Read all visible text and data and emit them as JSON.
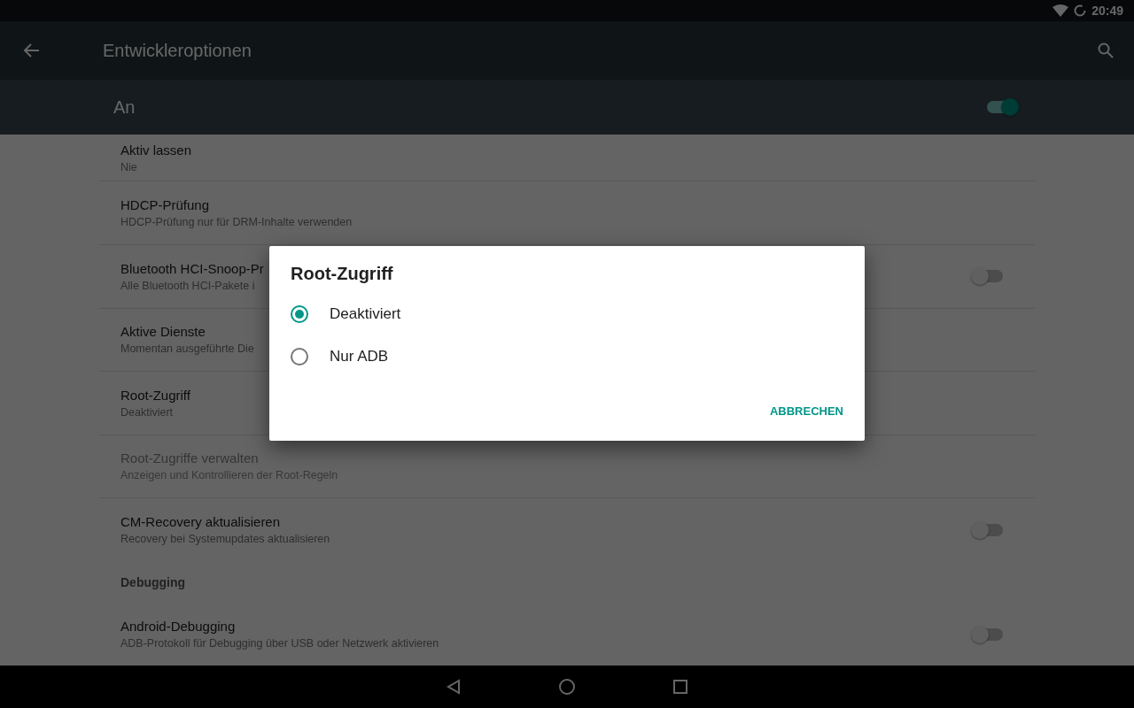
{
  "status_bar": {
    "time": "20:49"
  },
  "app_bar": {
    "title": "Entwickleroptionen"
  },
  "master_switch": {
    "label": "An",
    "on": true
  },
  "settings": [
    {
      "kind": "item",
      "title": "Aktiv lassen",
      "summary": "Nie",
      "disabled": false
    },
    {
      "kind": "item",
      "title": "HDCP-Prüfung",
      "summary": "HDCP-Prüfung nur für DRM-Inhalte verwenden",
      "disabled": false
    },
    {
      "kind": "switch",
      "title": "Bluetooth HCI-Snoop-Pr",
      "summary": "Alle Bluetooth HCI-Pakete i",
      "disabled": false,
      "on": false
    },
    {
      "kind": "item",
      "title": "Aktive Dienste",
      "summary": "Momentan ausgeführte Die",
      "disabled": false
    },
    {
      "kind": "item",
      "title": "Root-Zugriff",
      "summary": "Deaktiviert",
      "disabled": false
    },
    {
      "kind": "item",
      "title": "Root-Zugriffe verwalten",
      "summary": "Anzeigen und Kontrollieren der Root-Regeln",
      "disabled": true
    },
    {
      "kind": "switch",
      "title": "CM-Recovery aktualisieren",
      "summary": "Recovery bei Systemupdates aktualisieren",
      "disabled": false,
      "on": false
    },
    {
      "kind": "category",
      "title": "Debugging"
    },
    {
      "kind": "switch",
      "title": "Android-Debugging",
      "summary": "ADB-Protokoll für Debugging über USB oder Netzwerk aktivieren",
      "disabled": false,
      "on": false
    }
  ],
  "dialog": {
    "title": "Root-Zugriff",
    "options": [
      {
        "label": "Deaktiviert",
        "selected": true
      },
      {
        "label": "Nur ADB",
        "selected": false
      }
    ],
    "buttons": [
      "ABBRECHEN"
    ]
  }
}
